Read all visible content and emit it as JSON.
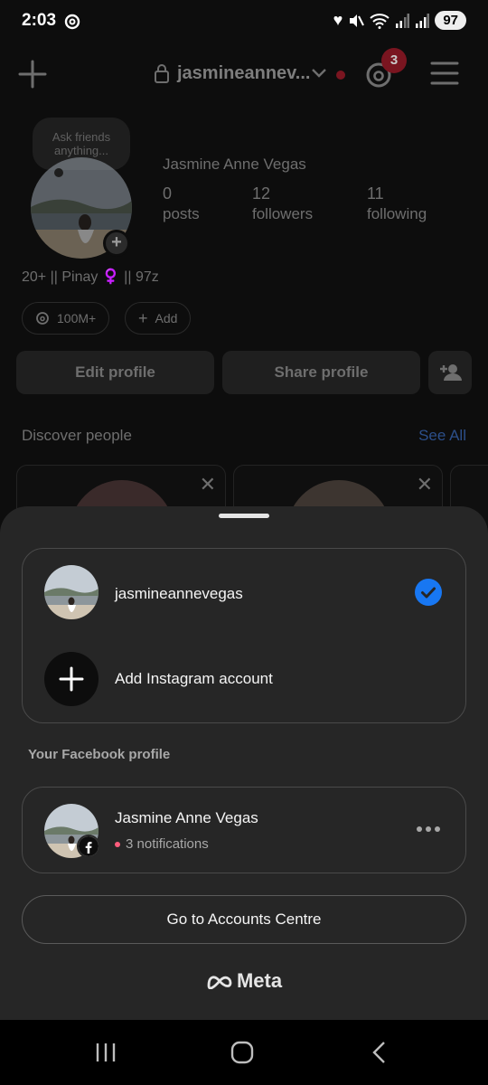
{
  "status_bar": {
    "time": "2:03",
    "battery": "97"
  },
  "profile": {
    "username": "jasmineannev...",
    "notification_count": "3",
    "note_text": "Ask friends anything...",
    "full_name": "Jasmine Anne Vegas",
    "stats": [
      {
        "value": "0",
        "label": "posts"
      },
      {
        "value": "12",
        "label": "followers"
      },
      {
        "value": "11",
        "label": "following"
      }
    ],
    "bio": "20+ || Pinay ♀️ || 97z",
    "threads_pill": "100M+",
    "add_pill": "Add",
    "edit_profile": "Edit profile",
    "share_profile": "Share profile",
    "discover_title": "Discover people",
    "see_all": "See All"
  },
  "sheet": {
    "accounts": [
      {
        "username": "jasmineannevegas",
        "selected": true
      }
    ],
    "add_account": "Add Instagram account",
    "facebook_heading": "Your Facebook profile",
    "facebook_name": "Jasmine Anne Vegas",
    "facebook_notifications": "3 notifications",
    "accounts_centre": "Go to Accounts Centre",
    "meta_logo": "Meta"
  },
  "colors": {
    "sheet_bg": "#262626",
    "check_blue": "#1877f2",
    "see_all_blue": "#2c4f8a",
    "badge_red": "#7a1520"
  }
}
